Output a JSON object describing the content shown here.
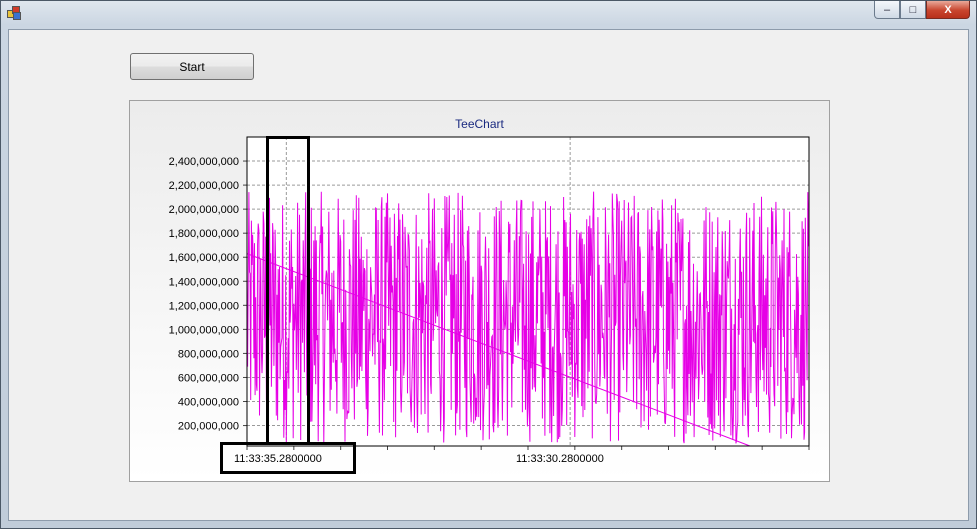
{
  "window": {
    "caption_buttons": {
      "minimize": "–",
      "maximize": "□",
      "close": "X"
    }
  },
  "toolbar": {
    "start_label": "Start"
  },
  "chart": {
    "title": "TeeChart",
    "x_tick_left": "11:33:35.2800000",
    "x_tick_middle": "11:33:30.2800000"
  },
  "chart_data": {
    "type": "line",
    "title": "TeeChart",
    "y_ticks": [
      "200,000,000",
      "400,000,000",
      "600,000,000",
      "800,000,000",
      "1,000,000,000",
      "1,200,000,000",
      "1,400,000,000",
      "1,600,000,000",
      "1,800,000,000",
      "2,000,000,000",
      "2,200,000,000",
      "2,400,000,000"
    ],
    "x_ticks": [
      "11:33:35.2800000",
      "11:33:30.2800000"
    ],
    "ylim": [
      30000000,
      2600000000
    ],
    "grid": true,
    "series": [
      {
        "color": "#e600e6",
        "description": "random noise values roughly between 50,000,000 and 2,150,000,000",
        "min": 50000000,
        "max": 2150000000
      },
      {
        "color": "#e600e6",
        "trend_start": 1630000000,
        "trend_end": 30000000
      }
    ],
    "highlight_color": "#000000"
  }
}
